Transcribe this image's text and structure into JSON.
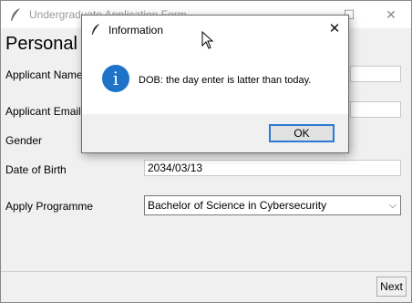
{
  "window": {
    "title": "Undergraduate Application Form",
    "min": "—",
    "max": "☐",
    "close": "✕"
  },
  "form": {
    "heading": "Personal",
    "applicant_name_label": "Applicant Name",
    "applicant_email_label": "Applicant Email",
    "gender_label": "Gender",
    "dob_label": "Date of Birth",
    "dob_value": "2034/03/13",
    "programme_label": "Apply Programme",
    "programme_value": "Bachelor of Science in Cybersecurity"
  },
  "footer": {
    "next_label": "Next"
  },
  "dialog": {
    "title": "Information",
    "close": "✕",
    "icon": "i",
    "message": "DOB: the day enter is latter than today.",
    "ok_label": "OK"
  },
  "colors": {
    "info_blue": "#1e73c8",
    "button_focus": "#2b7bd6"
  }
}
